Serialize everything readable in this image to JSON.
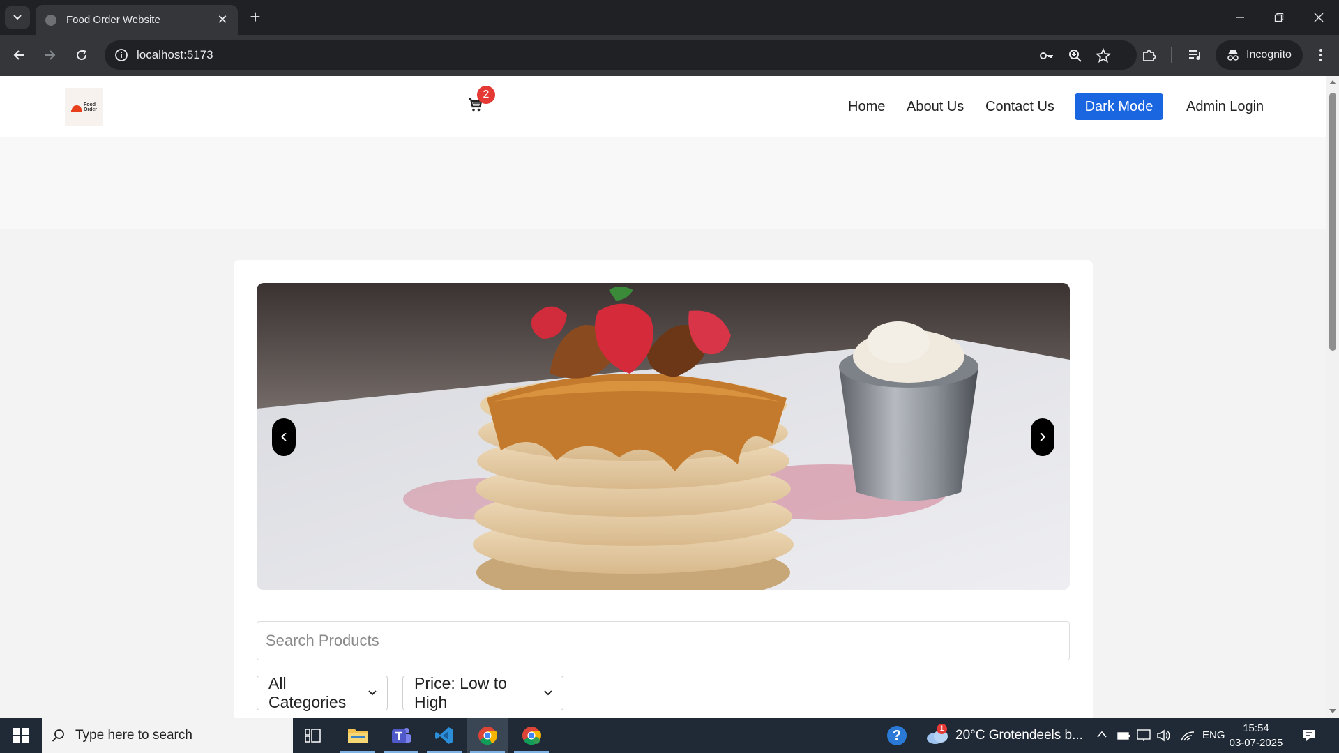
{
  "browser": {
    "tab_title": "Food Order Website",
    "url": "localhost:5173",
    "profile_label": "Incognito"
  },
  "site": {
    "logo_text_1": "Food",
    "logo_text_2": "Order",
    "cart_count": "2",
    "nav": {
      "home": "Home",
      "about": "About Us",
      "contact": "Contact Us",
      "dark_mode": "Dark Mode",
      "admin": "Admin Login"
    },
    "carousel": {
      "prev": "‹",
      "next": "›"
    },
    "search_placeholder": "Search Products",
    "category_select": "All Categories",
    "sort_select": "Price: Low to High"
  },
  "taskbar": {
    "search_placeholder": "Type here to search",
    "weather_badge": "1",
    "weather": "20°C  Grotendeels b...",
    "language": "ENG",
    "time": "15:54",
    "date": "03-07-2025"
  },
  "colors": {
    "accent": "#1a66e0",
    "badge": "#e53935"
  }
}
